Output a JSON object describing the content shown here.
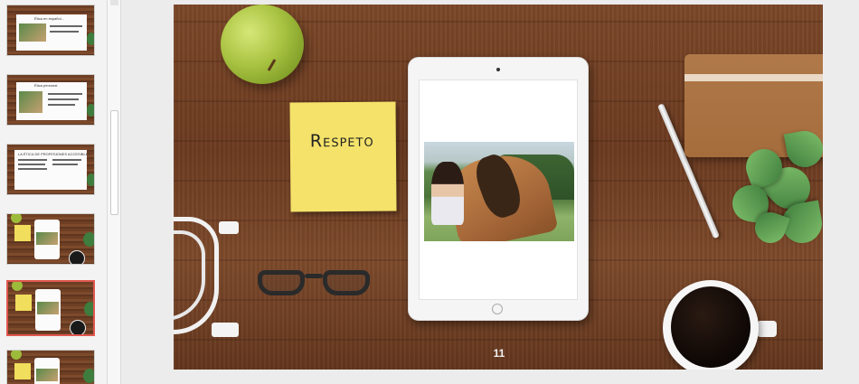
{
  "thumbnails": [
    {
      "id": "thumb-1",
      "title": "Ética en español..."
    },
    {
      "id": "thumb-2",
      "title": "Ética personal"
    },
    {
      "id": "thumb-3",
      "title": "LA ÉTICA DE PROFESIONES ACCESIBLES"
    },
    {
      "id": "thumb-4",
      "title": ""
    },
    {
      "id": "thumb-5",
      "title": "",
      "selected": true
    },
    {
      "id": "thumb-6",
      "title": ""
    }
  ],
  "slide": {
    "sticky_note": "Respeto",
    "slide_number": "11"
  }
}
